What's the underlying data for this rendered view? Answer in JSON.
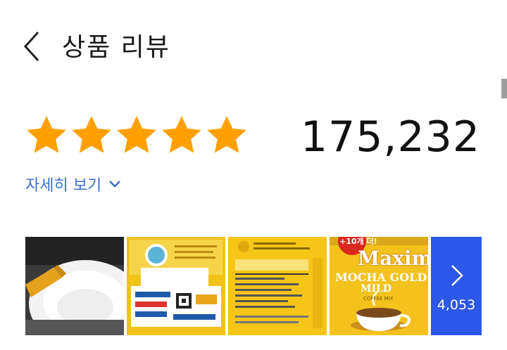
{
  "header": {
    "title": "상품 리뷰"
  },
  "rating": {
    "stars": 5,
    "max_stars": 5,
    "count": "175,232"
  },
  "details": {
    "label": "자세히 보기"
  },
  "photos": {
    "items": [
      {
        "name": "photo-coffee-cup"
      },
      {
        "name": "photo-box-back"
      },
      {
        "name": "photo-nutrition-label"
      },
      {
        "name": "photo-maxim-box",
        "badge": "+10개 더!",
        "brand": "Maxim",
        "line1": "MOCHA GOLD",
        "line2": "MILD",
        "sub": "COFFEE MIX"
      }
    ],
    "more_count": "4,053"
  },
  "colors": {
    "star": "#ffa000",
    "link": "#3b6fd0",
    "more_bg": "#2d57e8"
  }
}
